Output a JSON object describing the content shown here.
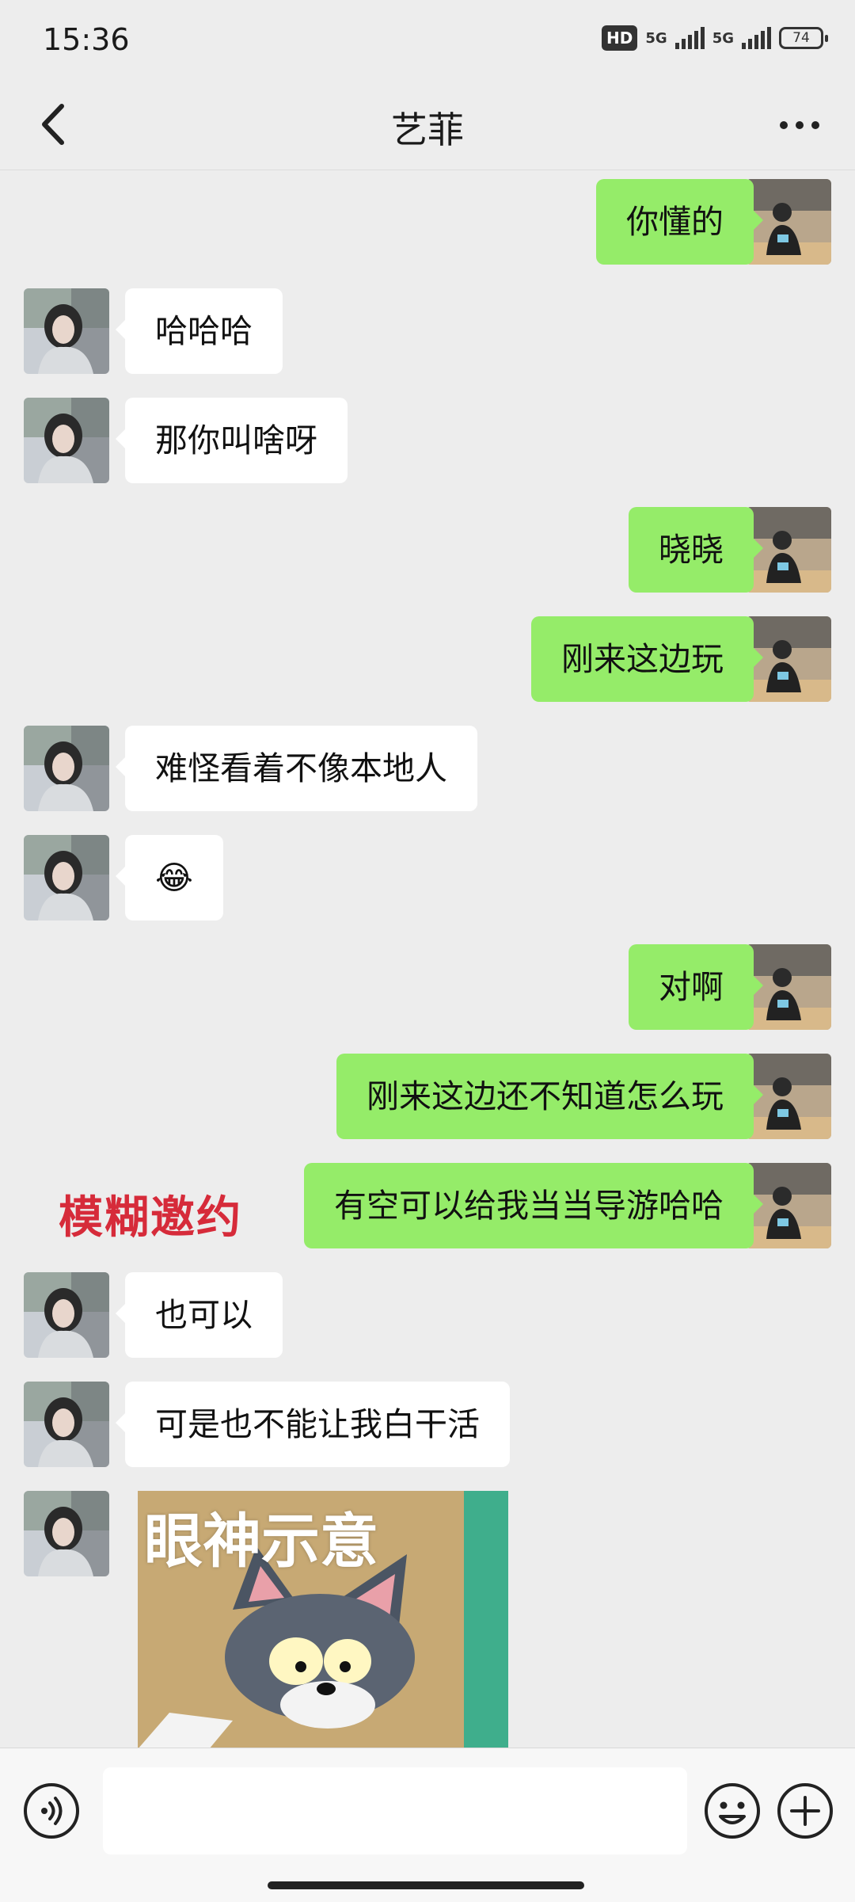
{
  "status": {
    "time": "15:36",
    "hd": "HD",
    "net1": "5G",
    "net2": "5G",
    "battery": "74"
  },
  "header": {
    "title": "艺菲"
  },
  "messages": [
    {
      "side": "right",
      "text": "你懂的"
    },
    {
      "side": "left",
      "text": "哈哈哈"
    },
    {
      "side": "left",
      "text": "那你叫啥呀"
    },
    {
      "side": "right",
      "text": "晓晓"
    },
    {
      "side": "right",
      "text": "刚来这边玩"
    },
    {
      "side": "left",
      "text": "难怪看着不像本地人"
    },
    {
      "side": "left",
      "text": "😂"
    },
    {
      "side": "right",
      "text": "对啊"
    },
    {
      "side": "right",
      "text": "刚来这边还不知道怎么玩"
    },
    {
      "side": "right",
      "text": "有空可以给我当当导游哈哈"
    },
    {
      "side": "left",
      "text": "也可以"
    },
    {
      "side": "left",
      "text": "可是也不能让我白干活"
    }
  ],
  "overlay": {
    "text": "模糊邀约"
  },
  "sticker": {
    "caption": "眼神示意"
  },
  "colors": {
    "accent": "#95ec69",
    "overlay": "#d62b3a",
    "background": "#ededed"
  },
  "icons": {
    "back": "chevron-left-icon",
    "more": "more-dots-icon",
    "voice": "voice-icon",
    "emoji": "emoji-icon",
    "plus": "plus-icon"
  }
}
